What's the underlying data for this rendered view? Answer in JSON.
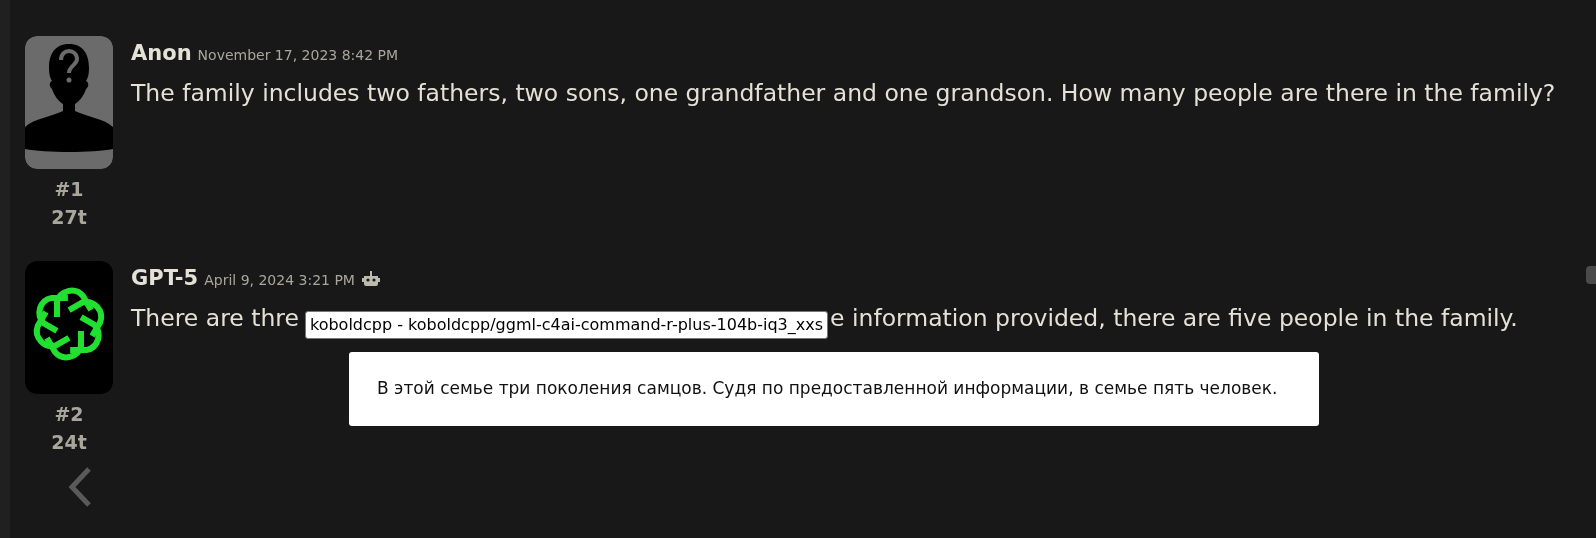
{
  "posts": [
    {
      "author": "Anon",
      "date": "November 17, 2023 8:42 PM",
      "avatar": {
        "kind": "silhouette"
      },
      "bot": false,
      "message": [
        "The family includes two fathers, two sons, one grandfather and one grandson. How many people are there in the family?"
      ],
      "number": "#1",
      "tokens": "27t"
    },
    {
      "author": "GPT-5",
      "date": "April 9, 2024 3:21 PM",
      "avatar": {
        "kind": "logo"
      },
      "bot": true,
      "message": [
        "There are thre",
        "e information provided, there are five people in the family."
      ],
      "tooltip": "koboldcpp - koboldcpp/ggml-c4ai-command-r-plus-104b-iq3_xxs",
      "number": "#2",
      "tokens": "24t"
    }
  ],
  "translation": "В этой семье три поколения самцов. Судя по предоставленной информации, в семье пять человек."
}
